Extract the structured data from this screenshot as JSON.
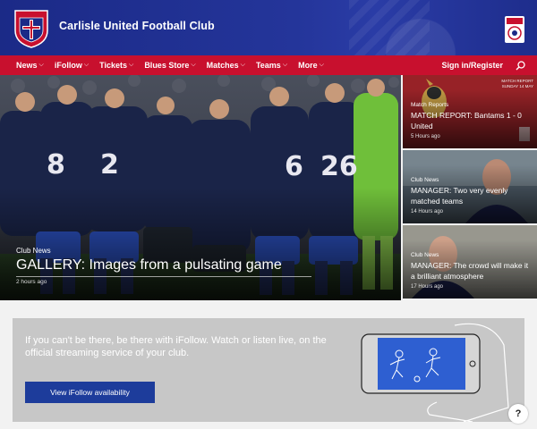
{
  "header": {
    "club_name": "Carlisle United Football Club",
    "crest_text_top": "CARLISLE UNITED",
    "crest_text_bottom": "FOOTBALL CLUB"
  },
  "nav": {
    "items": [
      {
        "label": "News",
        "icon": "chevron-down-icon"
      },
      {
        "label": "iFollow",
        "icon": "chevron-down-icon"
      },
      {
        "label": "Tickets",
        "icon": "chevron-down-icon"
      },
      {
        "label": "Blues Store",
        "icon": "chevron-down-icon"
      },
      {
        "label": "Matches",
        "icon": "chevron-down-icon"
      },
      {
        "label": "Teams",
        "icon": "chevron-down-icon"
      },
      {
        "label": "More",
        "icon": "chevron-down-icon"
      }
    ],
    "sign_in": "Sign in/Register",
    "search_icon": "search-icon"
  },
  "hero": {
    "category": "Club News",
    "title": "GALLERY: Images from a pulsating game",
    "time": "2 hours ago",
    "shirt_numbers": [
      "8",
      "2",
      "6",
      "26"
    ]
  },
  "side_cards": [
    {
      "category": "Match Reports",
      "title": "MATCH REPORT: Bantams 1 - 0 United",
      "time": "5 Hours ago",
      "badge": "MATCH REPORT\nSUNDAY 14 MAY"
    },
    {
      "category": "Club News",
      "title": "MANAGER: Two very evenly matched teams",
      "time": "14 Hours ago"
    },
    {
      "category": "Club News",
      "title": "MANAGER: The crowd will make it a brilliant atmosphere",
      "time": "17 Hours ago"
    }
  ],
  "ifollow": {
    "text": "If you can't be there, be there with iFollow. Watch or listen live, on the official streaming service of your club.",
    "button": "View iFollow availability"
  },
  "help": {
    "label": "?"
  },
  "colors": {
    "brand_blue": "#1b2a87",
    "nav_red": "#c8102e",
    "button_blue": "#1d3c9b"
  }
}
